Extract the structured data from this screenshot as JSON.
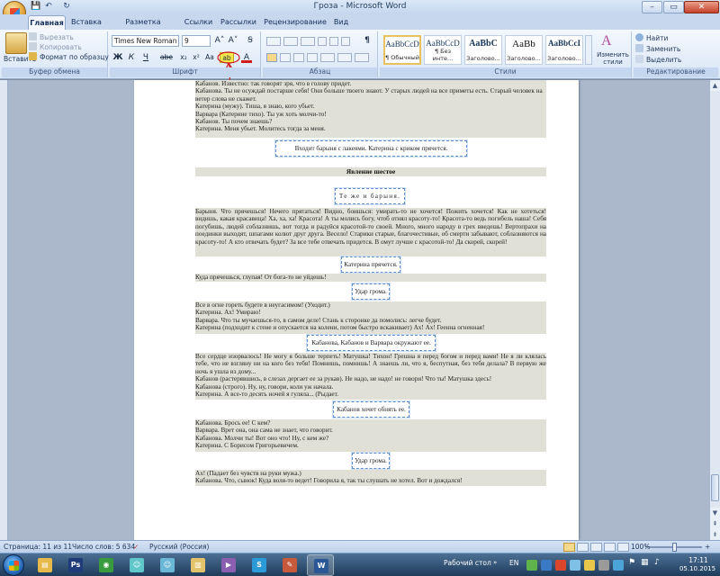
{
  "window": {
    "title": "Гроза - Microsoft Word",
    "controls": {
      "minimize": "–",
      "maximize": "▭",
      "close": "✕"
    }
  },
  "quick_access": {
    "save": "💾",
    "undo": "↶",
    "redo": "↻"
  },
  "tabs": [
    "Главная",
    "Вставка",
    "Разметка страницы",
    "Ссылки",
    "Рассылки",
    "Рецензирование",
    "Вид"
  ],
  "ribbon": {
    "clipboard": {
      "paste": "Вставить",
      "cut": "Вырезать",
      "copy": "Копировать",
      "format_painter": "Формат по образцу",
      "group_label": "Буфер обмена"
    },
    "font": {
      "family": "Times New Roman (C",
      "size": "9",
      "grow": "A˄",
      "shrink": "A˅",
      "clear": "Ꞩ",
      "bold": "Ж",
      "italic": "К",
      "underline": "Ч",
      "strike": "abe",
      "subscript": "x₂",
      "superscript": "x²",
      "case": "Aa",
      "highlight": "ab",
      "font_color": "A",
      "group_label": "Шрифт"
    },
    "paragraph": {
      "group_label": "Абзац",
      "show_marks": "¶"
    },
    "styles": {
      "group_label": "Стили",
      "items": [
        {
          "sample": "AaBbCcD",
          "name": "¶ Обычный"
        },
        {
          "sample": "AaBbCcD",
          "name": "¶ Без инте..."
        },
        {
          "sample": "AaBbC",
          "name": "Заголово..."
        },
        {
          "sample": "AaBb",
          "name": "Заголово..."
        },
        {
          "sample": "AaBbCcI",
          "name": "Заголово..."
        }
      ],
      "change": "Изменить стили"
    },
    "editing": {
      "find": "Найти",
      "replace": "Заменить",
      "select": "Выделить",
      "group_label": "Редактирование"
    }
  },
  "document": {
    "block1": [
      "Кабанов. Известно: так говорят зря, что в голову придет.",
      "Кабанова. Ты не осуждай постарше себя! Они больше твоего знают. У старых людей на все приметы есть. Старый человек на ветер слова не скажет.",
      "Катерина (мужу). Тиша, я знаю, кого убьет.",
      "Варвара (Катерине тихо). Ты уж хоть молчи-то!",
      "Кабанов. Ты почем знаешь?",
      "Катерина. Меня убьет. Молитесь тогда за меня."
    ],
    "frame_enter": "Входит барыня с лакеями. Катерина с криком прячется.",
    "scene_heading": "Явление шестое",
    "frame_same": "Те же и барыня.",
    "barynya_speech": "Барыня. Что прячешься! Нечего прятаться! Видно, боишься: умирать-то не хочется! Пожить хочется! Как не хотеться! видишь, какая красавица! Ха, ха, ха! Красота! А ты молись богу, чтоб отнял красоту-то! Красота-то ведь погибель наша! Себя погубишь, людей соблазнишь, вот тогда и радуйся красотой-то своей. Много, много народу в грех введешь! Вертопрахи на поединки выходят, шпагами колют друг друга. Весело! Старики старые, благочестивые, об смерти забывают, соблазняются на красоту-то! А кто отвечать будет? За все тебе отвечать придется. В омут лучше с красотой-то! Да скорей, скорей!",
    "frame_hides": "Катерина прячется.",
    "where_hide": "Куда прячешься, глупая! От бога-то не уйдешь!",
    "frame_thunder1": "Удар грома.",
    "block_fire": [
      "Все в огне гореть будете в неугасимом! (Уходит.)",
      "Катерина. Ах! Умираю!",
      "Варвара. Что ты мучаешься-то, в самом деле! Стань к сторонке да помолись: легче будет.",
      "Катерина (подходит к стене и опускается на колени, потом быстро вскакивает) Ах! Ах! Геенна огненная!"
    ],
    "frame_surround": "Кабанова, Кабанов и Варвара окружают ее.",
    "block_confess": [
      "Все сердце изорвалось! Не могу я больше терпеть! Матушка! Тихон! Грешна я перед богом и перед вами! Не я ли клялась тебе, что не взгляну ни на кого без тебя! Помнишь, помнишь! А знаешь ли, что я, беспутная, без тебя делала? В первую же ночь я ушла из дому...",
      "Кабанов (растерявшись, в слезах дергает ее за рукав). Не надо, не надо! не говори! Что ты! Матушка здесь!",
      "Кабанова (строго). Ну, ну, говори, коли уж начала.",
      "Катерина. А все-то десять ночей я гуляла... (Рыдает."
    ],
    "frame_hug": "Кабанов хочет обнять ее.",
    "block_tell": [
      "Кабанова. Брось ее! С кем?",
      "Варвара. Врет она, она сама не знает, что говорит.",
      "Кабанова. Молчи ты! Вот оно что! Ну, с кем же?",
      "Катерина. С Борисом Григорьевичем."
    ],
    "frame_thunder2": "Удар грома.",
    "block_end": [
      "Ах! (Падает без чувств на руки мужа.)",
      "Кабанова. Что, сынок! Куда воля-то ведет! Говорила я, так ты слушать не хотел. Вот и дождался!"
    ]
  },
  "statusbar": {
    "page": "Страница: 11 из 11",
    "words": "Число слов: 5 634",
    "language": "Русский (Россия)",
    "zoom": "100%",
    "zoom_minus": "−",
    "zoom_plus": "+"
  },
  "taskbar": {
    "apps": [
      {
        "icon": "explorer-icon",
        "glyph": "▤",
        "color": "#e6b94a"
      },
      {
        "icon": "photoshop-icon",
        "glyph": "Ps",
        "color": "#1f3b7a"
      },
      {
        "icon": "chrome-icon",
        "glyph": "◉",
        "color": "#3a9b3e"
      },
      {
        "icon": "anime-icon-1",
        "glyph": "☺",
        "color": "#5fc7c9"
      },
      {
        "icon": "anime-icon-2",
        "glyph": "☺",
        "color": "#6ab7d6"
      },
      {
        "icon": "folder-icon",
        "glyph": "▥",
        "color": "#e3c36a"
      },
      {
        "icon": "media-icon",
        "glyph": "▶",
        "color": "#8a5fb0"
      },
      {
        "icon": "skype-icon",
        "glyph": "S",
        "color": "#2a9ad8"
      },
      {
        "icon": "paint-icon",
        "glyph": "✎",
        "color": "#c75a3a"
      },
      {
        "icon": "word-icon",
        "glyph": "W",
        "color": "#2b5797"
      }
    ],
    "desktop": "Рабочий стол",
    "lang": "EN",
    "time": "17:11",
    "date": "05.10.2015"
  }
}
